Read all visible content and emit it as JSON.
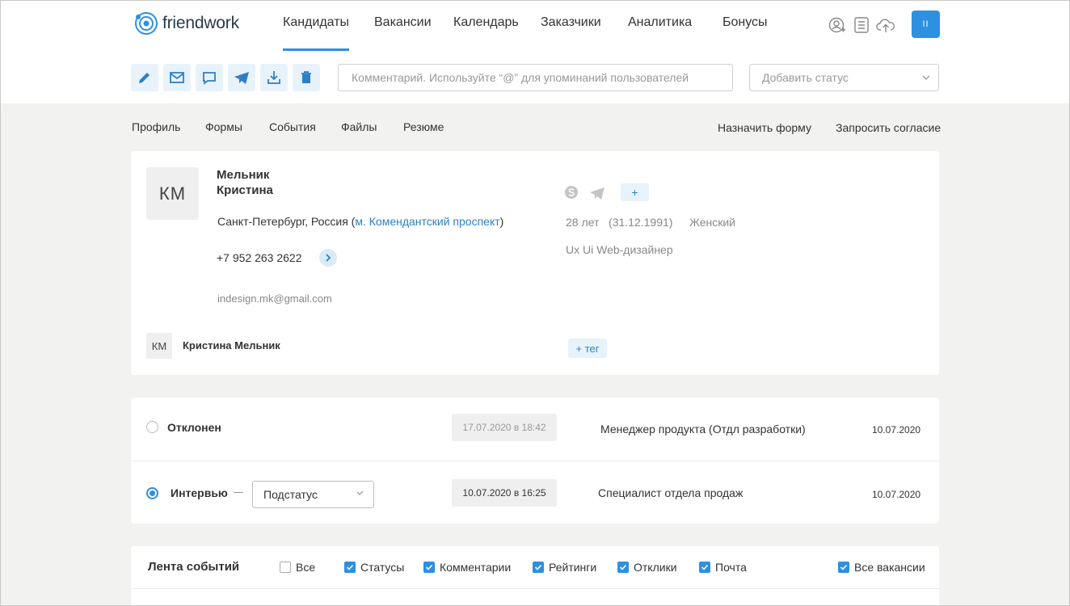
{
  "app": {
    "logo_text": "friendwork"
  },
  "nav": {
    "items": [
      {
        "label": "Кандидаты",
        "active": true
      },
      {
        "label": "Вакансии"
      },
      {
        "label": "Календарь"
      },
      {
        "label": "Заказчики"
      },
      {
        "label": "Аналитика"
      },
      {
        "label": "Бонусы"
      }
    ],
    "user_button": "II"
  },
  "toolbar": {
    "buttons": [
      "edit-icon",
      "mail-icon",
      "chat-icon",
      "telegram-icon",
      "download-icon",
      "trash-icon"
    ],
    "comment_placeholder": "Комментарий. Используйте “@” для упоминаний пользователей",
    "status_placeholder": "Добавить статус"
  },
  "subtabs": {
    "left": [
      "Профиль",
      "Формы",
      "События",
      "Файлы",
      "Резюме"
    ],
    "assign_form": "Назначить форму",
    "request_consent": "Запросить согласие"
  },
  "candidate": {
    "initials": "КМ",
    "last_name": "Мельник",
    "first_name": "Кристина",
    "city": "Санкт-Петербург, Россия",
    "metro": "м. Комендантский проспект",
    "phone": "+7 952 263 2622",
    "email": "indesign.mk@gmail.com",
    "owner_initials": "КМ",
    "owner_name": "Кристина Мельник",
    "age": "28 лет",
    "birthdate": "(31.12.1991)",
    "gender": "Женский",
    "position": "Ux Ui Web-дизайнер",
    "add_contact": "+",
    "add_tag": "+ тег"
  },
  "vacancies": [
    {
      "status": "Отклонен",
      "selected": false,
      "date": "17.07.2020 в 18:42",
      "name": "Менеджер продукта (Отдл разработки)",
      "added": "10.07.2020"
    },
    {
      "status": "Интервью",
      "selected": true,
      "substatus": "Подстатус",
      "date": "10.07.2020 в 16:25",
      "name": "Специалист отдела продаж",
      "added": "10.07.2020"
    }
  ],
  "feed": {
    "title": "Лента событий",
    "filters": [
      {
        "label": "Все",
        "checked": false
      },
      {
        "label": "Статусы",
        "checked": true
      },
      {
        "label": "Комментарии",
        "checked": true
      },
      {
        "label": "Рейтинги",
        "checked": true
      },
      {
        "label": "Отклики",
        "checked": true
      },
      {
        "label": "Почта",
        "checked": true
      }
    ],
    "all_vacancies": {
      "label": "Все вакансии",
      "checked": true
    }
  },
  "colors": {
    "accent": "#2d90e0",
    "link": "#2d7fc7",
    "background": "#f2f2f0"
  }
}
